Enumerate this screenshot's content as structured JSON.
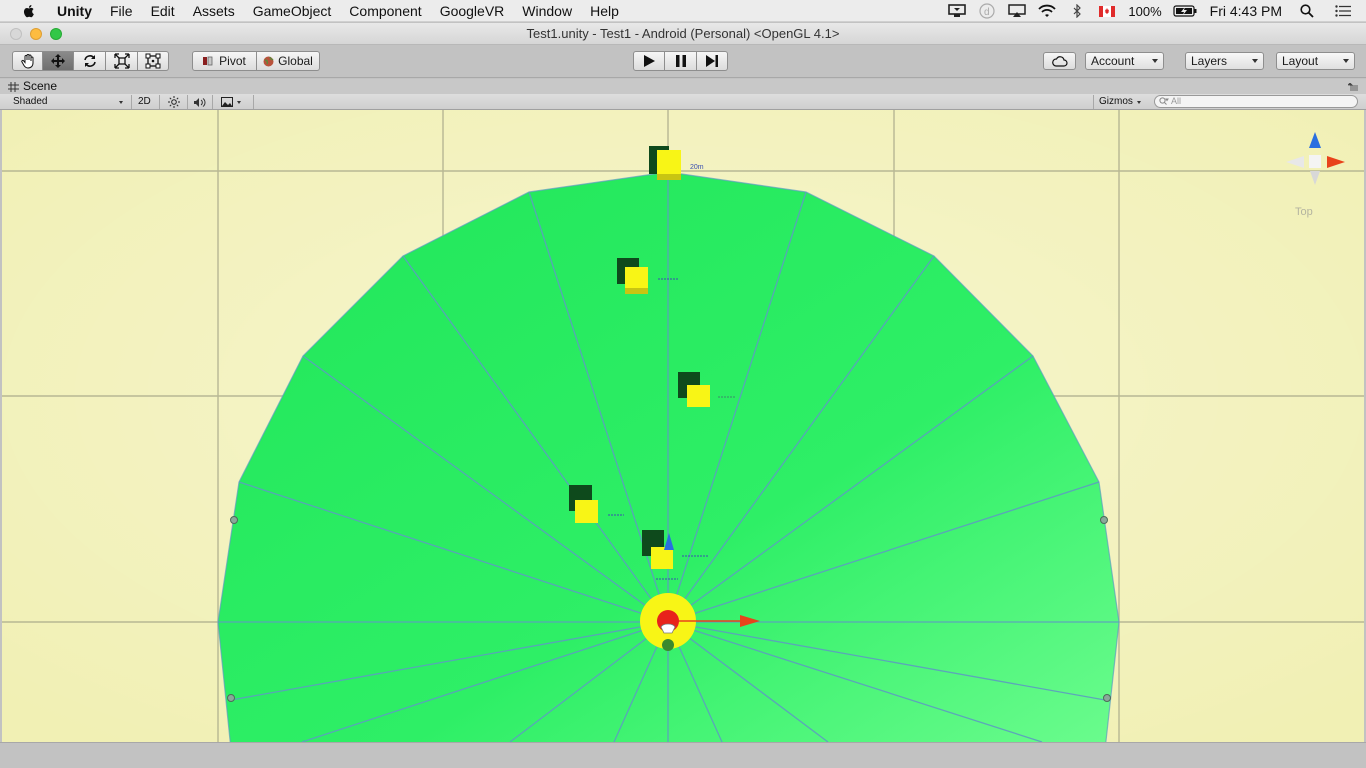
{
  "menubar": {
    "app": "Unity",
    "items": [
      "File",
      "Edit",
      "Assets",
      "GameObject",
      "Component",
      "GoogleVR",
      "Window",
      "Help"
    ],
    "battery": "100%",
    "clock": "Fri 4:43 PM"
  },
  "window": {
    "title": "Test1.unity - Test1 - Android (Personal) <OpenGL 4.1>"
  },
  "toolbar": {
    "transform_tools": [
      "hand-tool",
      "move-tool",
      "rotate-tool",
      "scale-tool",
      "rect-tool"
    ],
    "active_tool": "move-tool",
    "pivot_label": "Pivot",
    "global_label": "Global",
    "account_label": "Account",
    "layers_label": "Layers",
    "layout_label": "Layout"
  },
  "scene": {
    "tab_label": "Scene",
    "shading_mode": "Shaded",
    "mode_2d": "2D",
    "gizmos_label": "Gizmos",
    "search_placeholder": "All",
    "view_label": "Top",
    "distance_label": "20m"
  },
  "colors": {
    "ground": "#1fe85b",
    "background": "#f1f0b4",
    "cube": "#f8f516",
    "cube_shadow": "#0e4a1c",
    "axis_x": "#e8431b",
    "axis_y": "#2a6fe0"
  }
}
